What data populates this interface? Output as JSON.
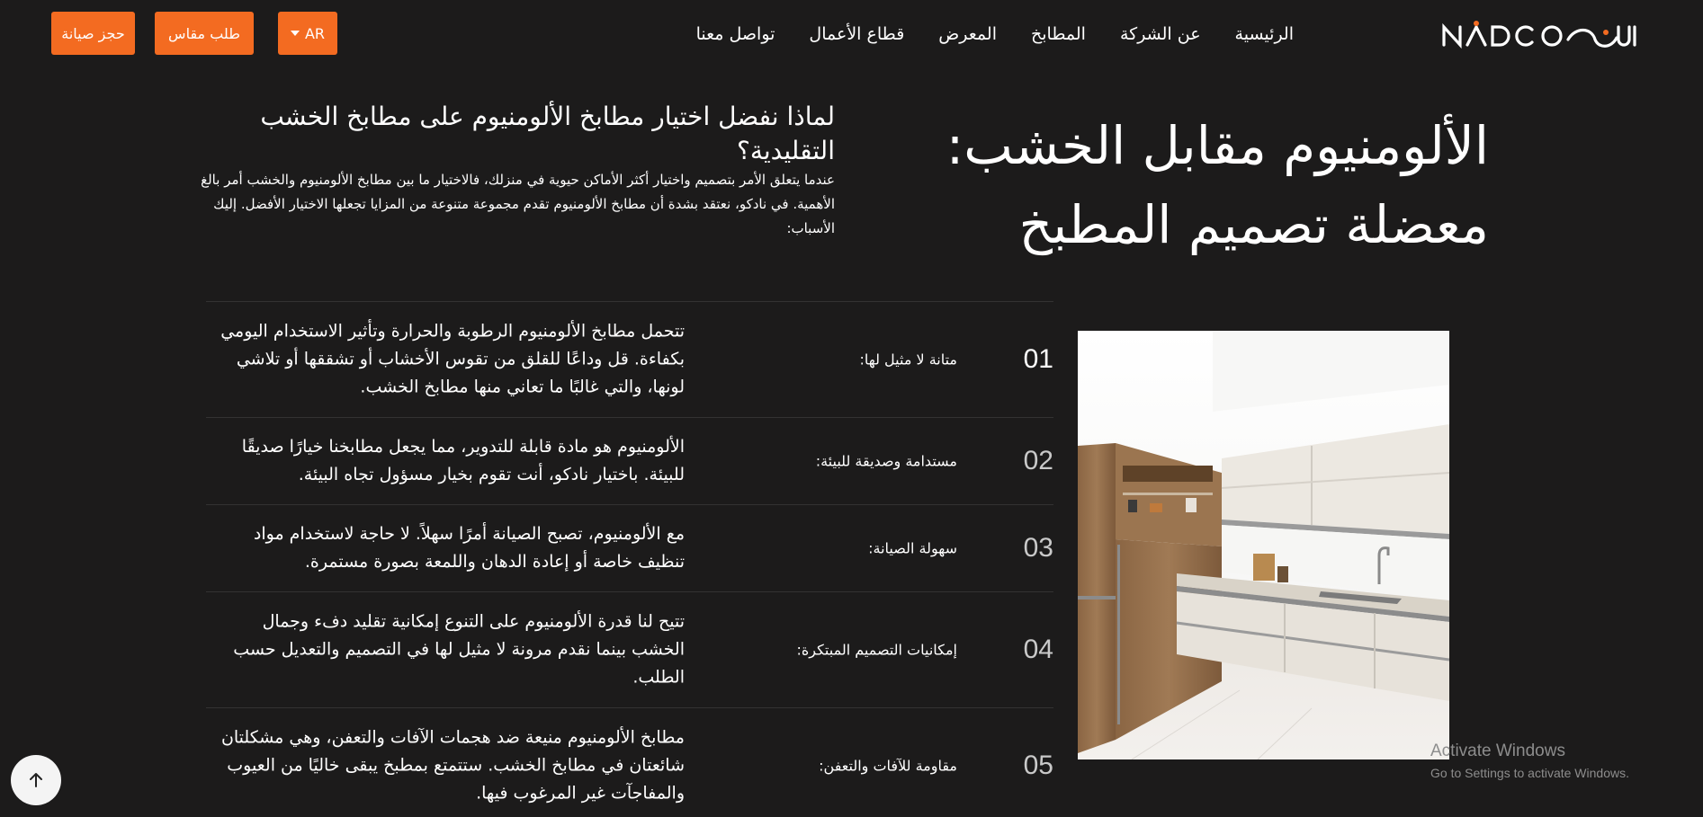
{
  "header": {
    "logo_text": "NADCO",
    "nav": [
      "الرئيسية",
      "عن الشركة",
      "المطابخ",
      "المعرض",
      "قطاع الأعمال",
      "تواصل معنا"
    ],
    "lang_label": "AR",
    "measure_label": "طلب مقاس",
    "maintenance_label": "حجز صيانة"
  },
  "hero": {
    "title_line1": "الألومنيوم مقابل الخشب:",
    "title_line2": "معضلة تصميم المطبخ"
  },
  "intro": {
    "title": "لماذا نفضل اختيار مطابخ الألومنيوم على مطابخ الخشب التقليدية؟",
    "text": "عندما يتعلق الأمر بتصميم واختيار أكثر الأماكن حيوية في منزلك، فالاختيار ما بين مطابخ الألومنيوم والخشب أمر بالغ الأهمية. في نادكو، نعتقد بشدة أن مطابخ الألومنيوم تقدم مجموعة متنوعة من المزايا تجعلها الاختيار الأفضل. إليك الأسباب:"
  },
  "features": [
    {
      "num": "01",
      "label": "متانة لا مثيل لها:",
      "desc": "تتحمل مطابخ الألومنيوم الرطوبة والحرارة وتأثير الاستخدام اليومي بكفاءة. قل وداعًا للقلق من تقوس الأخشاب أو تشققها أو تلاشي لونها، والتي غالبًا ما تعاني منها مطابخ الخشب."
    },
    {
      "num": "02",
      "label": "مستدامة وصديقة للبيئة:",
      "desc": "الألومنيوم هو مادة قابلة للتدوير، مما يجعل مطابخنا خيارًا صديقًا للبيئة. باختيار نادكو، أنت تقوم بخيار مسؤول تجاه البيئة."
    },
    {
      "num": "03",
      "label": "سهولة الصيانة:",
      "desc": "مع الألومنيوم، تصبح الصيانة أمرًا سهلاً. لا حاجة لاستخدام مواد تنظيف خاصة أو إعادة الدهان واللمعة بصورة مستمرة."
    },
    {
      "num": "04",
      "label": "إمكانيات التصميم المبتكرة:",
      "desc": "تتيح لنا قدرة الألومنيوم على التنوع إمكانية تقليد دفء وجمال الخشب بينما نقدم مرونة لا مثيل لها في التصميم والتعديل حسب الطلب."
    },
    {
      "num": "05",
      "label": "مقاومة للآفات والتعفن:",
      "desc": "مطابخ الألومنيوم منيعة ضد هجمات الآفات والتعفن، وهي مشكلتان شائعتان في مطابخ الخشب. ستتمتع بمطبخ يبقى خاليًا من العيوب والمفاجآت غير المرغوب فيها."
    }
  ],
  "watermark": {
    "line1": "Activate Windows",
    "line2": "Go to Settings to activate Windows."
  },
  "icons": {
    "scroll_top": "arrow-up-icon",
    "dropdown": "caret-down-icon"
  },
  "colors": {
    "accent": "#f36b21",
    "background": "#1c1b1b"
  }
}
